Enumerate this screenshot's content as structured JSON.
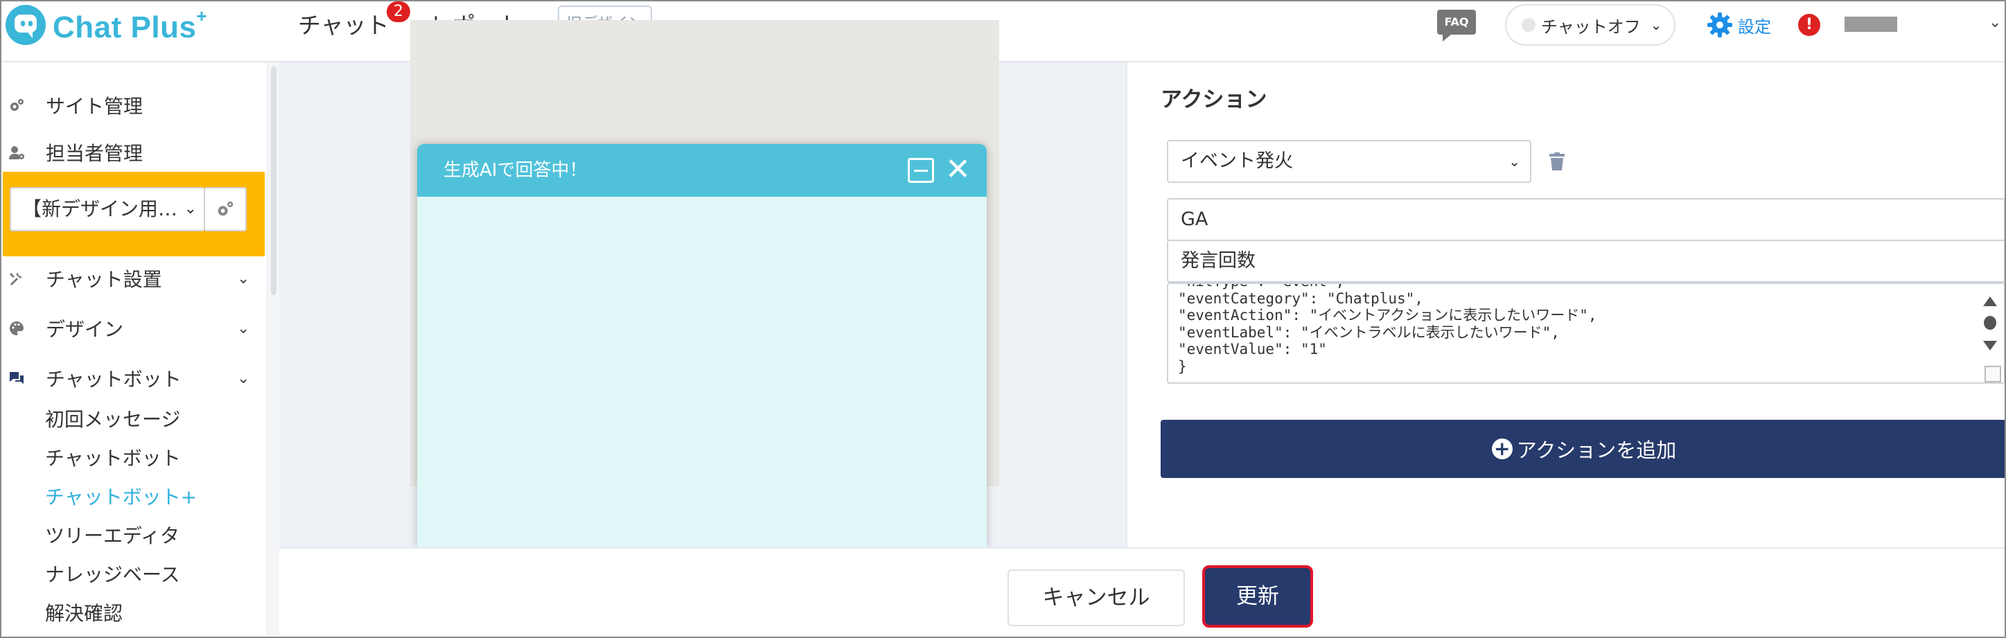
{
  "header": {
    "logo_text": "Chat Plus",
    "logo_sup": "+",
    "nav": [
      {
        "label": "チャット",
        "badge": "2"
      },
      {
        "label": "レポート"
      }
    ],
    "old_design_label": "旧デザイン",
    "faq_label": "FAQ",
    "chat_status_label": "チャットオフ",
    "settings_label": "設定",
    "alert_label": "!"
  },
  "sidebar": {
    "top_items": [
      {
        "label": "サイト管理",
        "icon": "gears-icon"
      },
      {
        "label": "担当者管理",
        "icon": "user-gear-icon"
      }
    ],
    "site_select_value": "【新デザイン用…",
    "sections": [
      {
        "label": "チャット設置",
        "icon": "tools-icon"
      },
      {
        "label": "デザイン",
        "icon": "palette-icon"
      },
      {
        "label": "チャットボット",
        "icon": "chat-bubbles-icon"
      }
    ],
    "sub_items": [
      {
        "label": "初回メッセージ"
      },
      {
        "label": "チャットボット"
      },
      {
        "label": "チャットボット+",
        "active": true
      },
      {
        "label": "ツリーエディタ"
      },
      {
        "label": "ナレッジベース"
      },
      {
        "label": "解決確認"
      }
    ],
    "active_color": "#2fb1dc",
    "highlight_color": "#ffb800"
  },
  "preview": {
    "chat_title": "生成AIで回答中！",
    "header_color": "#4fc2da"
  },
  "panel": {
    "title": "アクション",
    "action_select_value": "イベント発火",
    "field_ga_value": "GA",
    "field_event_value": "発言回数",
    "code_lines": [
      "\"hitType\": \"event\",",
      "\"eventCategory\": \"Chatplus\",",
      "\"eventAction\": \"イベントアクションに表示したいワード\",",
      "\"eventLabel\": \"イベントラベルに表示したいワード\",",
      "\"eventValue\": \"1\"",
      "}"
    ],
    "add_action_label": "アクションを追加",
    "primary_color": "#263a6b"
  },
  "footer": {
    "cancel_label": "キャンセル",
    "update_label": "更新",
    "update_outline_color": "#e0152b"
  }
}
